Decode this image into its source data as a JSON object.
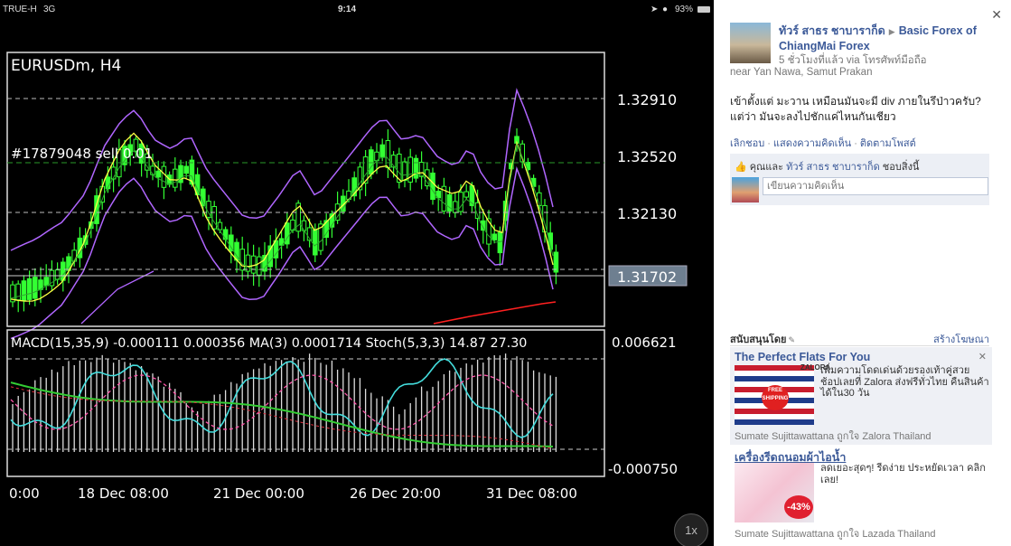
{
  "status_bar": {
    "carrier": "TRUE-H",
    "network": "3G",
    "time": "9:14",
    "battery": "93%"
  },
  "chart": {
    "symbol": "EURUSDm, H4",
    "order_label": "#17879048 sell 0.01",
    "price_ticks": [
      "1.32910",
      "1.32520",
      "1.32130"
    ],
    "current_price": "1.31702",
    "indicator_line": "MACD(15,35,9) -0.000111 0.000356 MA(3) 0.0001714 Stoch(5,3,3) 14.87 27.30",
    "macd_ticks": [
      "0.006621",
      "-0.000750"
    ],
    "time_ticks": [
      "0:00",
      "18 Dec 08:00",
      "21 Dec 00:00",
      "26 Dec 20:00",
      "31 Dec 08:00"
    ],
    "zoom_label": "1x",
    "colors": {
      "bull": "#33ff33",
      "bands": "#b066ff",
      "ma_yellow": "#ffff44",
      "ma_red": "#ff2020",
      "macd_cyan": "#44dddd",
      "macd_pink": "#ff55aa",
      "macd_green": "#33cc33"
    }
  },
  "post": {
    "author": "ทัวร์ สาธร ชาบาราก็ด",
    "target": "Basic Forex of ChiangMai Forex",
    "meta": "5 ชั่วโมงที่แล้ว via โทรศัพท์มือถือ",
    "location": "near Yan Nawa, Samut Prakan",
    "text": "เข้าตั้งแต่ มะวาน เหมือนมันจะมี div ภายในรึป่าวครับ?\nแต่ว่า มันจะลงไปชักแค่ไหนกันเชียว",
    "actions": [
      "เลิกชอบ",
      "แสดงความคิดเห็น",
      "ติดตามโพสต์"
    ],
    "likes": {
      "prefix": "คุณและ",
      "name": "ทัวร์ สาธร ชาบาราก็ด",
      "suffix": "ชอบสิ่งนี้"
    },
    "comment_placeholder": "เขียนความคิดเห็น",
    "close_icon": "close-icon"
  },
  "ads": {
    "header": "สนับสนุนโดย",
    "create": "สร้างโฆษณา",
    "items": [
      {
        "title": "The Perfect Flats For You",
        "description": "เพิ่มความโดดเด่นด้วยรองเท้าคู่สวย ช้อปเลยที่ Zalora ส่งฟรีทั่วไทย คืนสินค้าได้ใน30 วัน",
        "badge": "FREE SHIPPING",
        "brand": "ZALORA",
        "social": "Sumate Sujittawattana ถูกใจ Zalora Thailand"
      },
      {
        "title": "เครื่องรีดถนอมผ้าไอน้ำ",
        "description": "ลดเยอะสุดๆ! รีดง่าย ประหยัดเวลา คลิกเลย!",
        "badge": "-43%",
        "social": "Sumate Sujittawattana ถูกใจ Lazada Thailand"
      }
    ]
  }
}
